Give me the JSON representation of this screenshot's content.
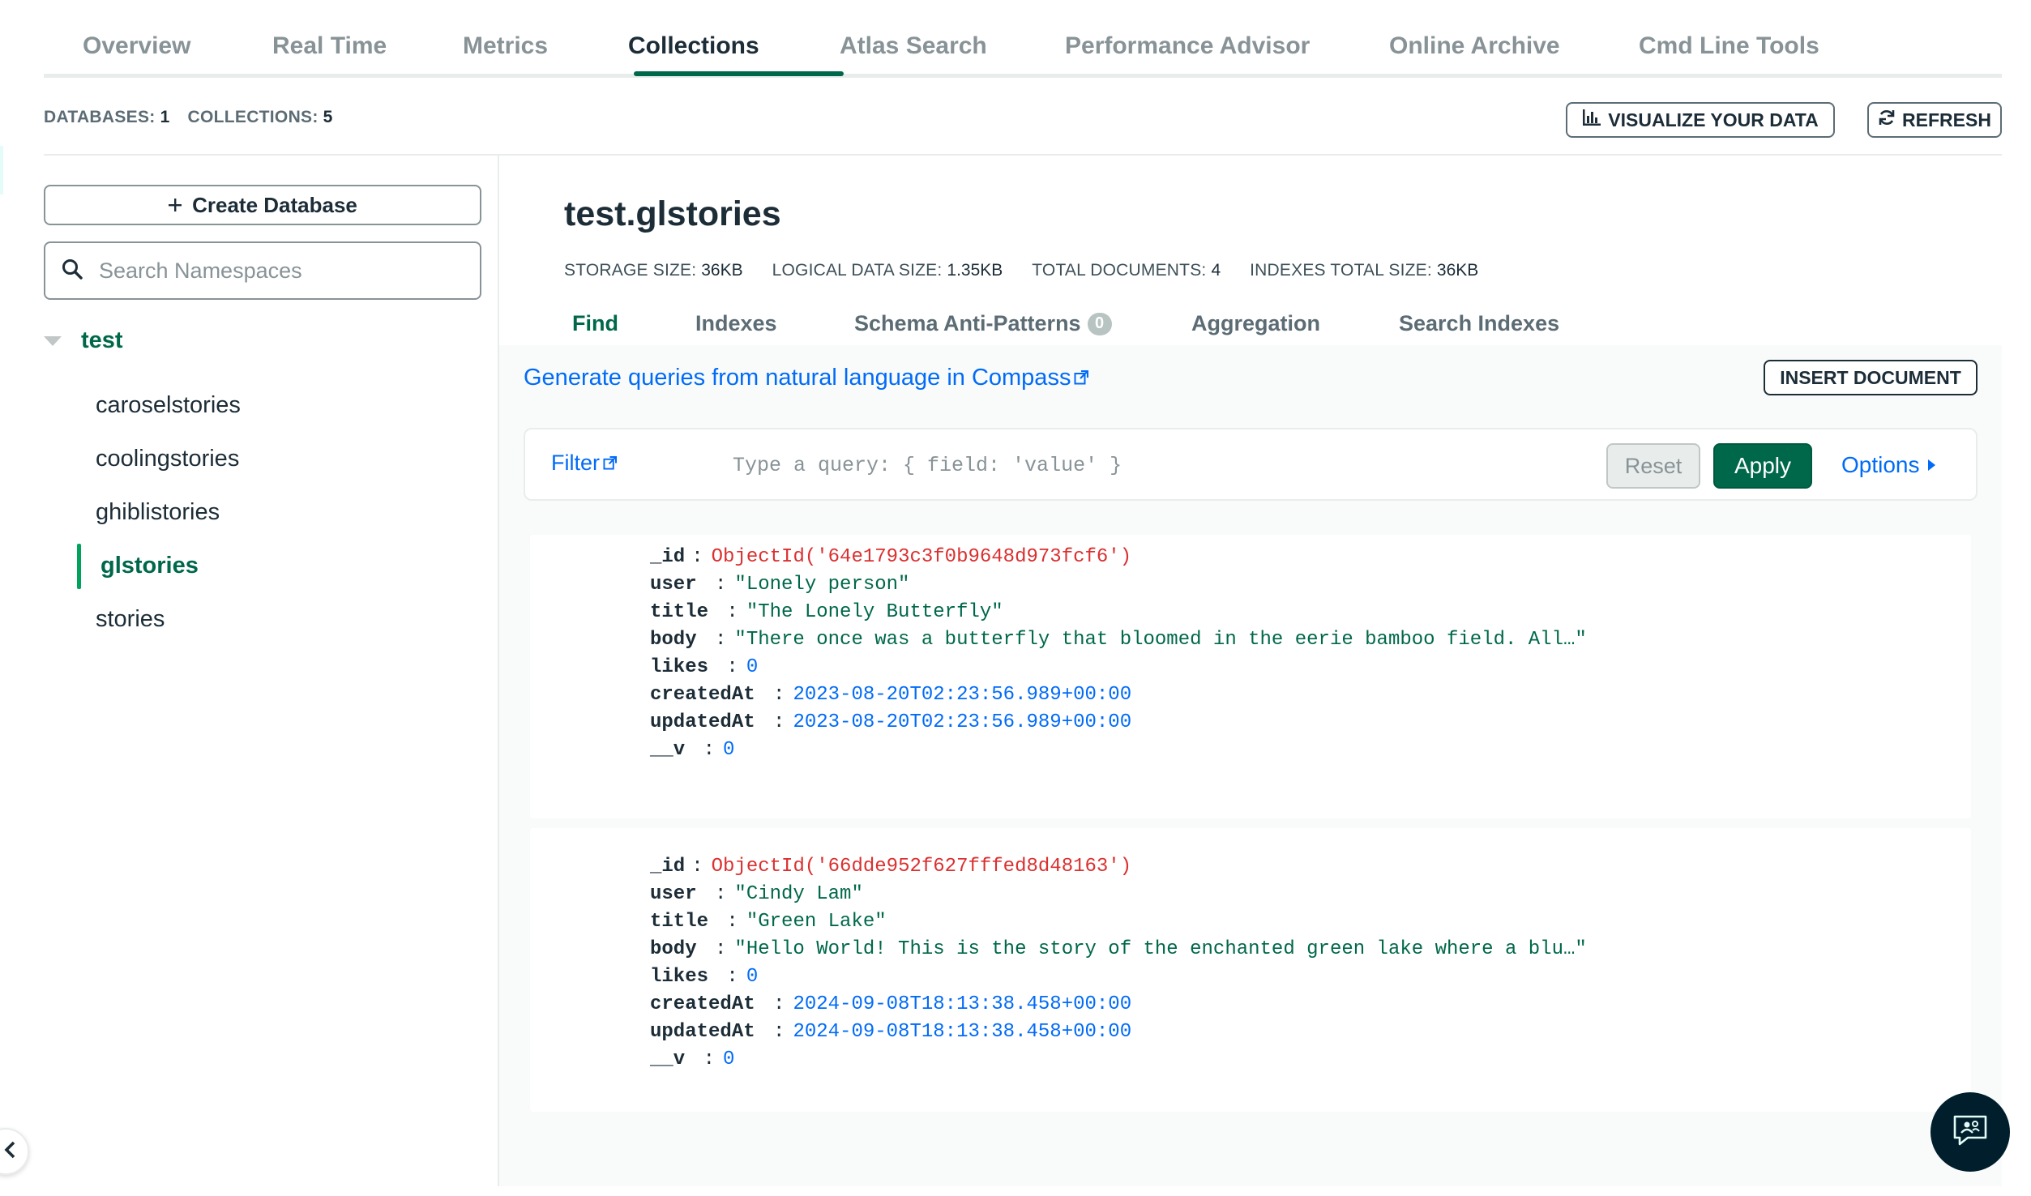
{
  "top_tabs": [
    "Overview",
    "Real Time",
    "Metrics",
    "Collections",
    "Atlas Search",
    "Performance Advisor",
    "Online Archive",
    "Cmd Line Tools"
  ],
  "active_top_tab": "Collections",
  "counts": {
    "databases_label": "DATABASES:",
    "databases_value": "1",
    "collections_label": "COLLECTIONS:",
    "collections_value": "5"
  },
  "header_buttons": {
    "visualize": "VISUALIZE YOUR DATA",
    "refresh": "REFRESH"
  },
  "sidebar": {
    "create_database": "Create Database",
    "search_placeholder": "Search Namespaces",
    "database": "test",
    "collections": [
      "caroselstories",
      "coolingstories",
      "ghiblistories",
      "glstories",
      "stories"
    ],
    "active_collection": "glstories"
  },
  "namespace": {
    "title": "test.glstories",
    "stats": [
      {
        "label": "STORAGE SIZE:",
        "value": "36KB"
      },
      {
        "label": "LOGICAL DATA SIZE:",
        "value": "1.35KB"
      },
      {
        "label": "TOTAL DOCUMENTS:",
        "value": "4"
      },
      {
        "label": "INDEXES TOTAL SIZE:",
        "value": "36KB"
      }
    ]
  },
  "sub_tabs": {
    "find": "Find",
    "indexes": "Indexes",
    "schema": "Schema Anti-Patterns",
    "schema_badge": "0",
    "aggregation": "Aggregation",
    "search_indexes": "Search Indexes"
  },
  "nl_link": "Generate queries from natural language in Compass",
  "insert_document": "INSERT DOCUMENT",
  "query": {
    "filter_label": "Filter",
    "placeholder": "Type a query: { field: 'value' }",
    "reset": "Reset",
    "apply": "Apply",
    "options": "Options"
  },
  "documents": [
    {
      "_id": "ObjectId('64e1793c3f0b9648d973fcf6')",
      "user": "\"Lonely person\"",
      "title": "\"The Lonely Butterfly\"",
      "body": "\"There once was a butterfly that bloomed in the eerie bamboo field. All…\"",
      "likes": "0",
      "createdAt": "2023-08-20T02:23:56.989+00:00",
      "updatedAt": "2023-08-20T02:23:56.989+00:00",
      "__v": "0"
    },
    {
      "_id": "ObjectId('66dde952f627fffed8d48163')",
      "user": "\"Cindy Lam\"",
      "title": "\"Green Lake\"",
      "body": "\"Hello World! This is the story of the enchanted green lake where a blu…\"",
      "likes": "0",
      "createdAt": "2024-09-08T18:13:38.458+00:00",
      "updatedAt": "2024-09-08T18:13:38.458+00:00",
      "__v": "0"
    }
  ],
  "field_keys": [
    "_id",
    "user",
    "title",
    "body",
    "likes",
    "createdAt",
    "updatedAt",
    "__v"
  ],
  "icons": {
    "visualize": "bar-chart-icon",
    "refresh": "refresh-icon",
    "create": "plus-icon",
    "search": "search-icon",
    "caret": "caret-down-icon",
    "external": "external-link-icon",
    "options": "caret-right-icon",
    "collapse": "chevron-left-icon",
    "chat": "chat-icon"
  },
  "colors": {
    "brand_green": "#00684a",
    "link_blue": "#016bf8",
    "oid_red": "#db3030",
    "text_dark": "#1c2d38"
  }
}
